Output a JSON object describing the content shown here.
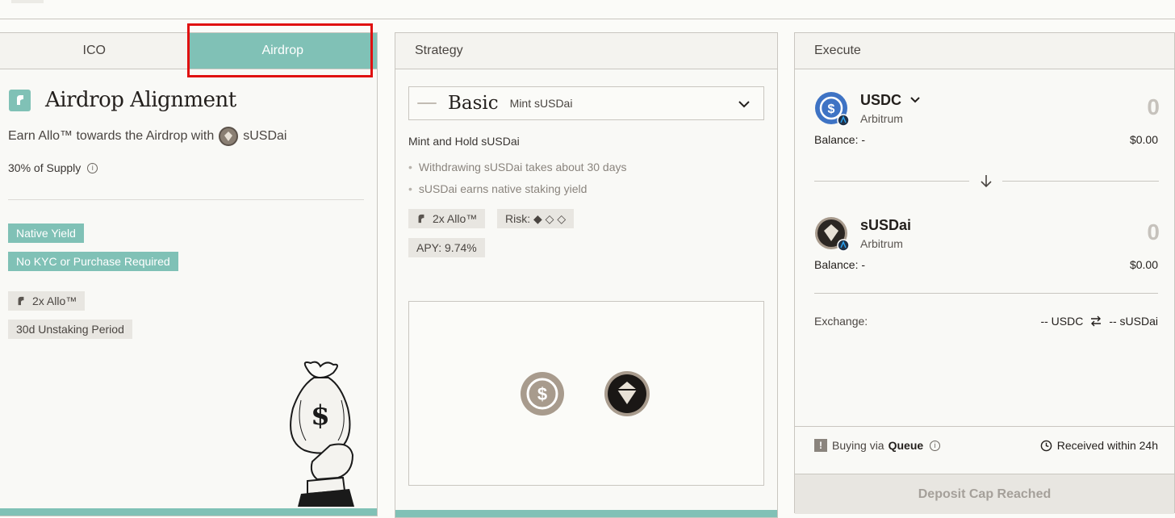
{
  "left": {
    "tabs": [
      "ICO",
      "Airdrop"
    ],
    "title": "Airdrop Alignment",
    "earn_text": "Earn Allo™ towards the Airdrop with",
    "earn_token": "sUSDai",
    "supply": "30% of Supply",
    "tags_teal": [
      "Native Yield",
      "No KYC or Purchase Required"
    ],
    "tags_grey": [
      "2x Allo™",
      "30d Unstaking Period"
    ]
  },
  "middle": {
    "header": "Strategy",
    "select_main": "Basic",
    "select_sub": "Mint sUSDai",
    "heading": "Mint and Hold sUSDai",
    "bullets": [
      "Withdrawing sUSDai takes about 30 days",
      "sUSDai earns native staking yield"
    ],
    "chip_allo": "2x Allo™",
    "chip_risk": "Risk: ◆ ◇ ◇",
    "chip_apy": "APY: 9.74%"
  },
  "right": {
    "header": "Execute",
    "from": {
      "name": "USDC",
      "network": "Arbitrum",
      "amount": "0",
      "balance_label": "Balance: -",
      "value": "$0.00"
    },
    "to": {
      "name": "sUSDai",
      "network": "Arbitrum",
      "amount": "0",
      "balance_label": "Balance: -",
      "value": "$0.00"
    },
    "exchange_label": "Exchange:",
    "exchange_from": "-- USDC",
    "exchange_to": "-- sUSDai",
    "buying_via": "Buying via",
    "queue": "Queue",
    "received": "Received within 24h",
    "deposit_button": "Deposit Cap Reached"
  },
  "colors": {
    "teal": "#80c1b6",
    "highlight": "#e01010",
    "usdc_blue": "#3e73c4"
  }
}
